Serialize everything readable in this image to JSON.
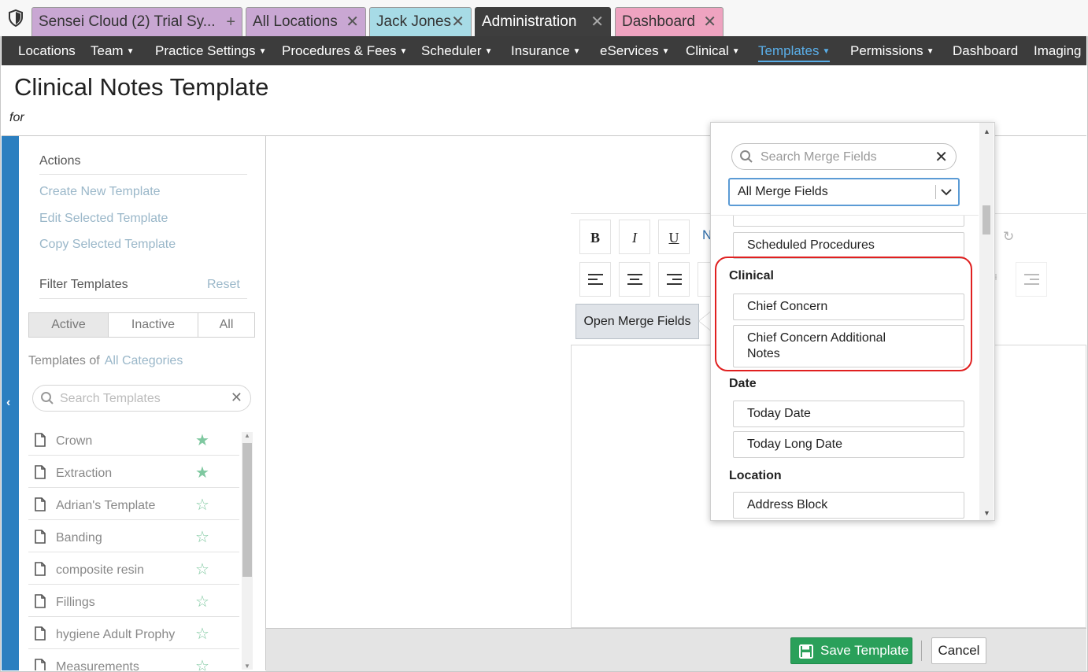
{
  "tabs": [
    {
      "label": "Sensei Cloud (2) Trial Sy...",
      "action_glyph": "+"
    },
    {
      "label": "All Locations",
      "action_glyph": "✕"
    },
    {
      "label": "Jack Jones",
      "action_glyph": "✕"
    },
    {
      "label": "Administration",
      "action_glyph": "✕"
    },
    {
      "label": "Dashboard",
      "action_glyph": "✕"
    }
  ],
  "nav": [
    {
      "label": "Locations",
      "has_menu": false
    },
    {
      "label": "Team",
      "has_menu": true
    },
    {
      "label": "Practice Settings",
      "has_menu": true
    },
    {
      "label": "Procedures & Fees",
      "has_menu": true
    },
    {
      "label": "Scheduler",
      "has_menu": true
    },
    {
      "label": "Insurance",
      "has_menu": true
    },
    {
      "label": "eServices",
      "has_menu": true
    },
    {
      "label": "Clinical",
      "has_menu": true
    },
    {
      "label": "Templates",
      "has_menu": true,
      "active": true
    },
    {
      "label": "Permissions",
      "has_menu": true
    },
    {
      "label": "Dashboard",
      "has_menu": false
    },
    {
      "label": "Imaging",
      "has_menu": false
    }
  ],
  "page": {
    "title": "Clinical Notes Template",
    "subtitle": "for"
  },
  "sidebar": {
    "actions_heading": "Actions",
    "actions": [
      "Create New Template",
      "Edit Selected Template",
      "Copy Selected Template"
    ],
    "filter_heading": "Filter Templates",
    "reset_label": "Reset",
    "status_filters": [
      "Active",
      "Inactive",
      "All"
    ],
    "templates_of_label": "Templates of",
    "category_label": "All Categories",
    "search_placeholder": "Search Templates",
    "templates": [
      {
        "name": "Crown",
        "favorite": true
      },
      {
        "name": "Extraction",
        "favorite": true
      },
      {
        "name": "Adrian's Template",
        "favorite": false
      },
      {
        "name": "Banding",
        "favorite": false
      },
      {
        "name": "composite resin",
        "favorite": false
      },
      {
        "name": "Fillings",
        "favorite": false
      },
      {
        "name": "hygiene Adult Prophy",
        "favorite": false
      },
      {
        "name": "Measurements",
        "favorite": false
      }
    ]
  },
  "editor": {
    "bold": "B",
    "italic": "I",
    "underline": "U",
    "partial_button": "N",
    "open_merge_label": "Open Merge Fields"
  },
  "merge_popup": {
    "search_placeholder": "Search Merge Fields",
    "filter_value": "All Merge Fields",
    "items": [
      {
        "kind": "item",
        "label": "Scheduled Procedures"
      },
      {
        "kind": "group",
        "label": "Clinical"
      },
      {
        "kind": "item",
        "label": "Chief Concern"
      },
      {
        "kind": "item",
        "label": "Chief Concern Additional Notes"
      },
      {
        "kind": "group",
        "label": "Date"
      },
      {
        "kind": "item",
        "label": "Today Date"
      },
      {
        "kind": "item",
        "label": "Today Long Date"
      },
      {
        "kind": "group",
        "label": "Location"
      },
      {
        "kind": "item",
        "label": "Address Block"
      }
    ]
  },
  "footer": {
    "save_label": "Save Template",
    "cancel_label": "Cancel"
  },
  "colors": {
    "nav_bg": "#3c3c3c",
    "nav_active": "#5aaee8",
    "save_green": "#2aa05a",
    "sidebar_strip": "#2b7fc0",
    "highlight_red": "#e02020",
    "star_green": "#7fc8a0"
  }
}
